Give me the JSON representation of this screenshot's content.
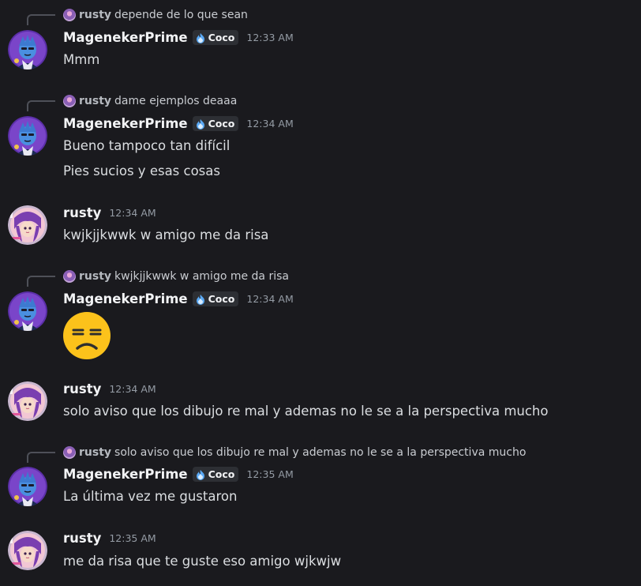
{
  "colors": {
    "background": "#1a1a1e",
    "username": "#f2f3f5",
    "timestamp": "#949ba4",
    "message_text": "#dbdee1",
    "tag_background": "#2d2f34"
  },
  "messages": [
    {
      "reply": {
        "author": "rusty",
        "text": "depende de lo que sean"
      },
      "author": "MagenekerPrime",
      "tag": {
        "label": "Coco",
        "icon": "flame-icon"
      },
      "time": "12:33 AM",
      "lines": [
        "Mmm"
      ]
    },
    {
      "reply": {
        "author": "rusty",
        "text": "dame ejemplos deaaa"
      },
      "author": "MagenekerPrime",
      "tag": {
        "label": "Coco",
        "icon": "flame-icon"
      },
      "time": "12:34 AM",
      "lines": [
        "Bueno tampoco tan difícil",
        "Pies sucios y esas cosas"
      ]
    },
    {
      "author": "rusty",
      "time": "12:34 AM",
      "lines": [
        "kwjkjjkwwk  w amigo me da risa"
      ]
    },
    {
      "reply": {
        "author": "rusty",
        "text": "kwjkjjkwwk  w amigo me da risa"
      },
      "author": "MagenekerPrime",
      "tag": {
        "label": "Coco",
        "icon": "flame-icon"
      },
      "time": "12:34 AM",
      "emoji": "unamused-face-emoji"
    },
    {
      "author": "rusty",
      "time": "12:34 AM",
      "lines": [
        "solo aviso que los dibujo re mal y ademas no le se a la perspectiva mucho"
      ]
    },
    {
      "reply": {
        "author": "rusty",
        "text": "solo aviso que los dibujo re mal y ademas no le se a la perspectiva mucho"
      },
      "author": "MagenekerPrime",
      "tag": {
        "label": "Coco",
        "icon": "flame-icon"
      },
      "time": "12:35 AM",
      "lines": [
        "La última vez me gustaron"
      ]
    },
    {
      "author": "rusty",
      "time": "12:35 AM",
      "lines": [
        "me da risa que te guste eso amigo wjkwjw"
      ]
    }
  ]
}
